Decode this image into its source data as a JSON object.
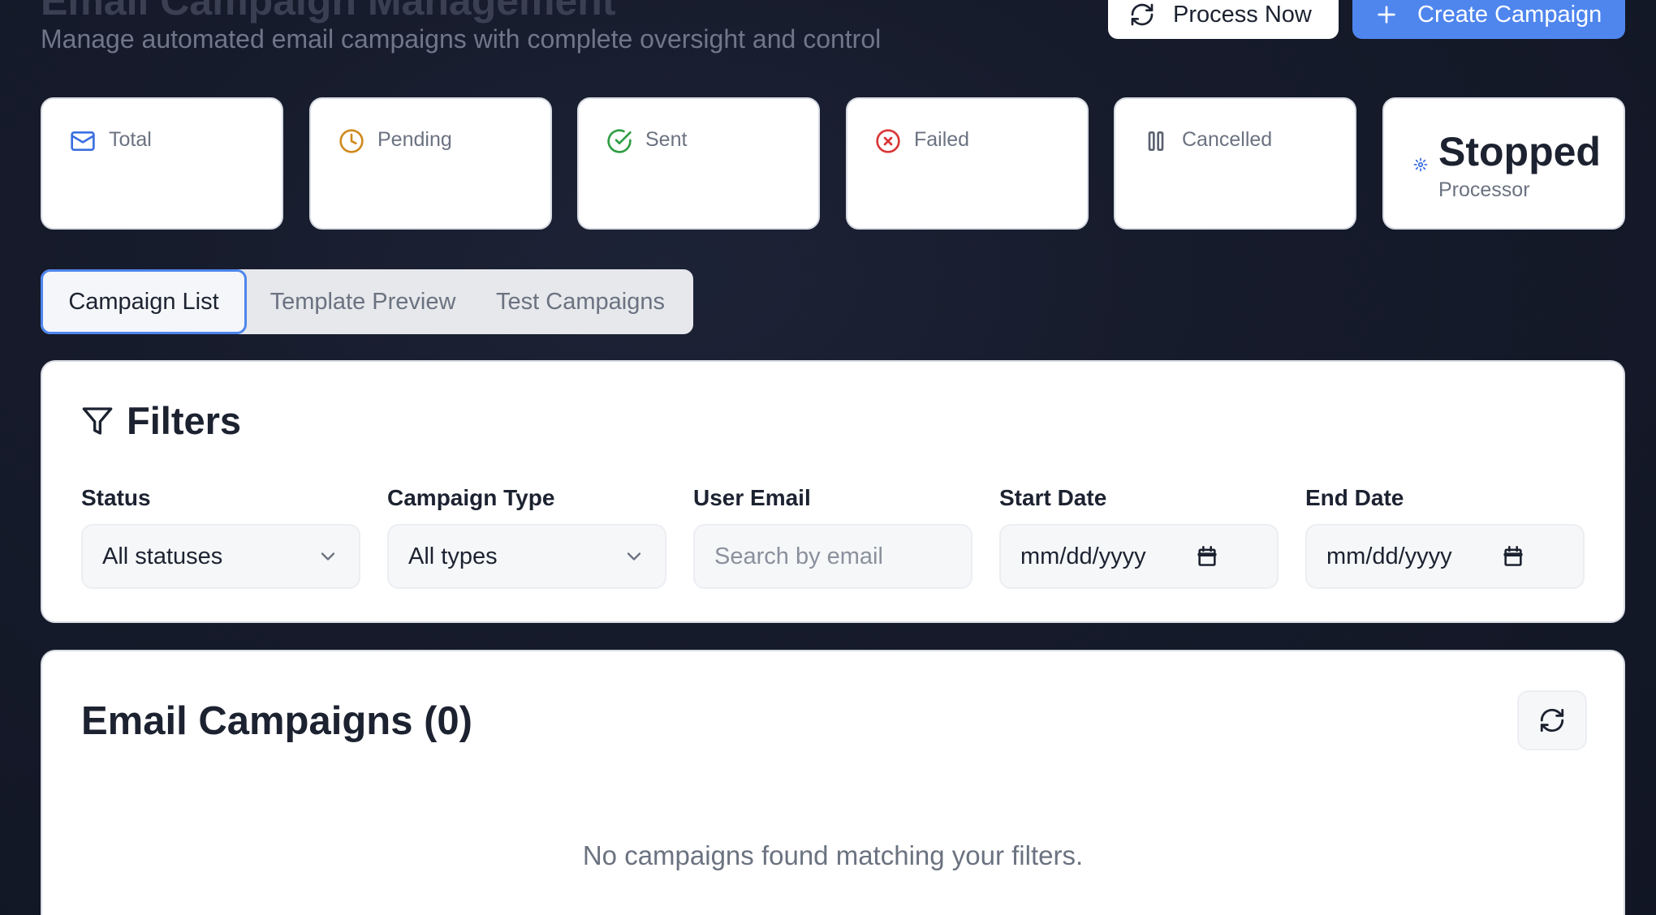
{
  "header": {
    "title": "Email Campaign Management",
    "subtitle": "Manage automated email campaigns with complete oversight and control",
    "process_now_label": "Process Now",
    "create_campaign_label": "Create Campaign"
  },
  "stats": {
    "total": {
      "label": "Total",
      "value": "",
      "color": "#3b6fe0",
      "icon": "mail-icon"
    },
    "pending": {
      "label": "Pending",
      "value": "",
      "color": "#d08a1e",
      "icon": "clock-icon"
    },
    "sent": {
      "label": "Sent",
      "value": "",
      "color": "#2f9e44",
      "icon": "check-circle-icon"
    },
    "failed": {
      "label": "Failed",
      "value": "",
      "color": "#d93636",
      "icon": "x-circle-icon"
    },
    "cancelled": {
      "label": "Cancelled",
      "value": "",
      "color": "#5b6270",
      "icon": "pause-icon"
    },
    "processor": {
      "status": "Stopped",
      "label": "Processor",
      "color": "#3b6fe0",
      "icon": "settings-icon"
    }
  },
  "tabs": [
    {
      "label": "Campaign List",
      "active": true
    },
    {
      "label": "Template Preview",
      "active": false
    },
    {
      "label": "Test Campaigns",
      "active": false
    }
  ],
  "filters": {
    "title": "Filters",
    "status": {
      "label": "Status",
      "value": "All statuses"
    },
    "campaign_type": {
      "label": "Campaign Type",
      "value": "All types"
    },
    "user_email": {
      "label": "User Email",
      "placeholder": "Search by email"
    },
    "start_date": {
      "label": "Start Date",
      "value": "mm/dd/yyyy"
    },
    "end_date": {
      "label": "End Date",
      "value": "mm/dd/yyyy"
    }
  },
  "campaigns": {
    "title": "Email Campaigns (0)",
    "empty_message": "No campaigns found matching your filters."
  },
  "colors": {
    "accent": "#4f86ee",
    "background": "#161b2b"
  }
}
